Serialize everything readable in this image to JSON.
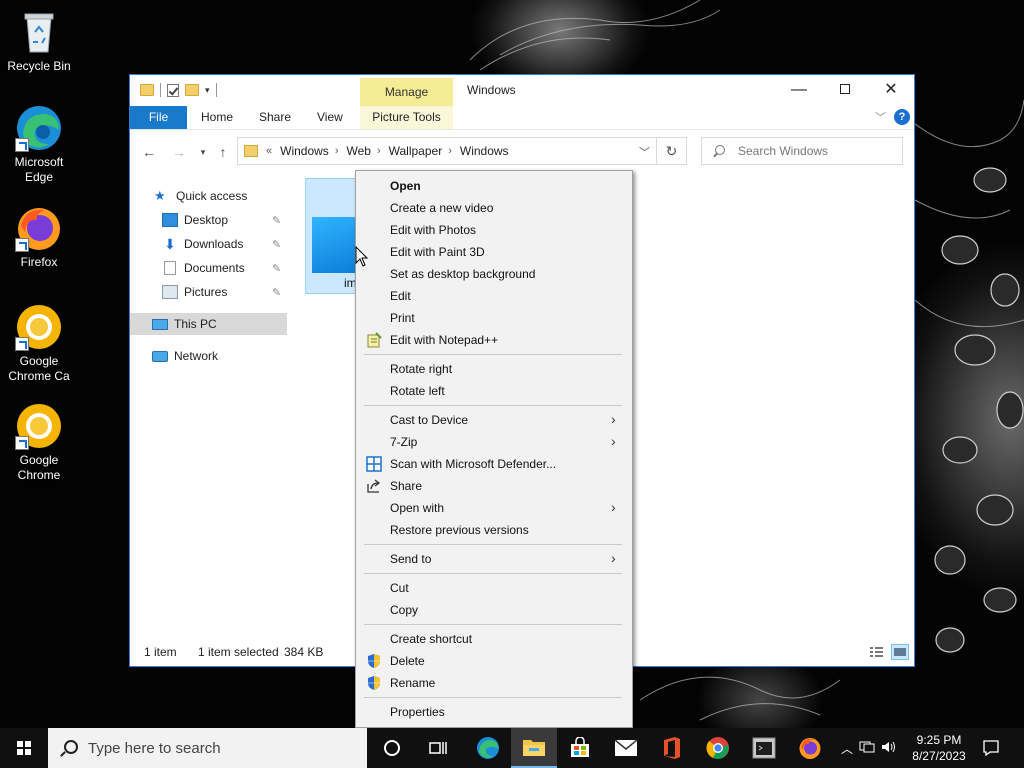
{
  "desktop": {
    "icons": [
      {
        "label": "Recycle Bin"
      },
      {
        "label": "Microsoft Edge"
      },
      {
        "label": "Firefox"
      },
      {
        "label": "Google Chrome Ca"
      },
      {
        "label": "Google Chrome"
      }
    ]
  },
  "window": {
    "title": "Windows",
    "contextual_tab": "Manage",
    "tabs": [
      "File",
      "Home",
      "Share",
      "View",
      "Picture Tools"
    ],
    "address": {
      "overflow": "«",
      "crumbs": [
        "Windows",
        "Web",
        "Wallpaper",
        "Windows"
      ]
    },
    "search_placeholder": "Search Windows",
    "nav": {
      "quick_access": "Quick access",
      "desktop": "Desktop",
      "downloads": "Downloads",
      "documents": "Documents",
      "pictures": "Pictures",
      "this_pc": "This PC",
      "network": "Network"
    },
    "file": {
      "name": "im"
    },
    "status": {
      "items": "1 item",
      "selected": "1 item selected",
      "size": "384 KB"
    }
  },
  "context_menu": {
    "open": "Open",
    "create_video": "Create a new video",
    "edit_photos": "Edit with Photos",
    "edit_paint3d": "Edit with Paint 3D",
    "set_background": "Set as desktop background",
    "edit": "Edit",
    "print": "Print",
    "edit_notepadpp": "Edit with Notepad++",
    "rotate_right": "Rotate right",
    "rotate_left": "Rotate left",
    "cast": "Cast to Device",
    "zip": "7-Zip",
    "defender": "Scan with Microsoft Defender...",
    "share": "Share",
    "open_with": "Open with",
    "restore": "Restore previous versions",
    "send_to": "Send to",
    "cut": "Cut",
    "copy": "Copy",
    "create_shortcut": "Create shortcut",
    "delete": "Delete",
    "rename": "Rename",
    "properties": "Properties"
  },
  "taskbar": {
    "search_placeholder": "Type here to search",
    "time": "9:25 PM",
    "date": "8/27/2023"
  },
  "colors": {
    "accent": "#1979ca",
    "manage_tab": "#f5ed96",
    "selection": "#cce8ff"
  }
}
